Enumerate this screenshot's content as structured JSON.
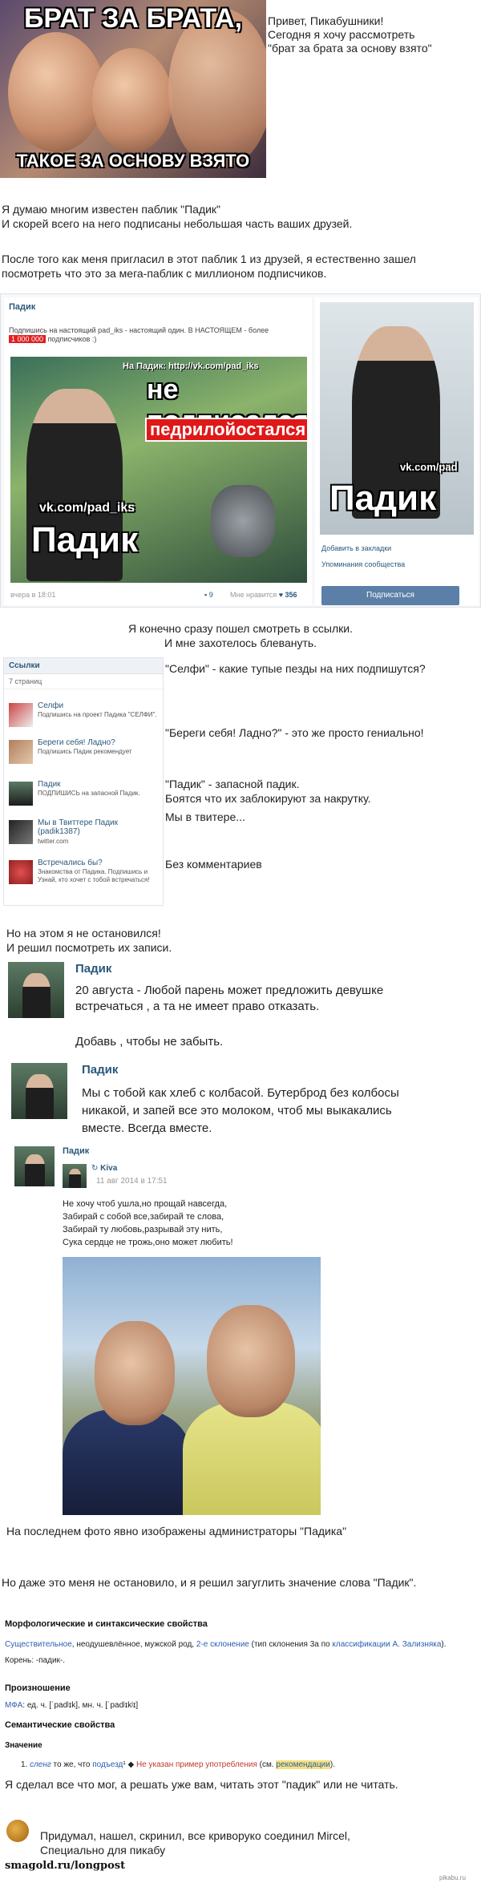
{
  "meme": {
    "top_text": "БРАТ ЗА БРАТА,",
    "bottom_text": "ТАКОЕ ЗА ОСНОВУ ВЗЯТО"
  },
  "intro": {
    "line1": "Привет, Пикабушники!",
    "line2": "Сегодня я хочу рассмотреть",
    "line3": "\"брат за брата за основу взято\""
  },
  "para1": {
    "line1": "Я думаю многим известен паблик \"Падик\"",
    "line2": "И скорей всего на него подписаны небольшая часть ваших друзей."
  },
  "para2": {
    "line1": "После того как меня пригласил в этот паблик 1 из друзей, я естественно зашел",
    "line2": "посмотреть что это за мега-паблик с миллионом подписчиков."
  },
  "vk_public": {
    "name": "Падик",
    "desc_line1": "Подпишись на настоящий pad_iks - настоящий один. В НАСТОЯЩЕМ - более",
    "desc_count": "1 000 000",
    "desc_line2": "подписчиков :)",
    "poster_url": "На Падик: http://vk.com/pad_iks",
    "poster_line1": "не подписался",
    "poster_line2": "педрилойостался",
    "poster_wm": "vk.com/pad_iks",
    "poster_big": "Падик",
    "time": "вчера в 18:01",
    "comments": "9",
    "likes_label": "Мне нравится",
    "likes": "356",
    "side_wm": "vk.com/pad",
    "side_big": "Падик",
    "bookmark": "Добавить в закладки",
    "mentions": "Упоминания сообщества",
    "subscribe": "Подписаться"
  },
  "links_intro": {
    "line1": "Я конечно сразу пошел смотреть в ссылки.",
    "line2": "И мне захотелось блевануть."
  },
  "links_panel": {
    "header": "Ссылки",
    "count": "7 страниц",
    "items": [
      {
        "title": "Селфи",
        "desc": "Подпишись на проект Падика \"СЕЛФИ\"."
      },
      {
        "title": "Береги себя! Ладно?",
        "desc": "Подпишись Падик рекомендует"
      },
      {
        "title": "Падик",
        "desc": "ПОДПИШИСЬ на запасной Падик."
      },
      {
        "title": "Мы в Твиттере Падик (padik1387)",
        "desc": "twitter.com"
      },
      {
        "title": "Встречались бы?",
        "desc": "Знакомства от Падика. Подпишись и Узнай, кто хочет с тобой встречаться!"
      }
    ]
  },
  "comments": {
    "c1": "\"Селфи\" - какие тупые пезды на них подпишутся?",
    "c2": "\"Береги себя! Ладно?\" - это же просто гениально!",
    "c3a": "\"Падик\" - запасной падик.",
    "c3b": "Боятся что их заблокируют за накрутку.",
    "c4": "Мы в твитере...",
    "c5": "Без комментариев"
  },
  "para3": {
    "line1": "Но на этом я не остановился!",
    "line2": "И решил посмотреть их записи."
  },
  "post1": {
    "name": "Падик",
    "line1": "20 августа - Любой парень может предложить девушке",
    "line2": "встречаться , а та не имеет право отказать.",
    "line3": "Добавь , чтобы не забыть."
  },
  "post2": {
    "name": "Падик",
    "line1": "Мы с тобой как хлеб с колбасой. Бутерброд без колбосы",
    "line2": "никакой, и запей все это молоком, чтоб мы выкакались",
    "line3": "вместе. Всегда вместе."
  },
  "post3": {
    "name": "Падик",
    "repost_name": "Kiva",
    "repost_date": "11 авг 2014 в 17:51",
    "lines": [
      "Не хочу чтоб ушла,но прощай навсегда,",
      "Забирай с собой все,забирай те слова,",
      "Забирай ту любовь,разрывай эту нить,",
      "Сука сердце не трожь,оно может любить!"
    ]
  },
  "para4": "На последнем фото явно изображены администраторы \"Падика\"",
  "para5": "Но даже это меня не остановило, и я решил загуглить значение слова \"Падик\".",
  "dictionary": {
    "h1": "Морфологические и синтаксические свойства",
    "morph_a": "Существительное",
    "morph_b": ", неодушевлённое, мужской род, ",
    "morph_c": "2-е склонение",
    "morph_d": " (тип склонения 3а по ",
    "morph_e": "классификации А. Зализняка",
    "morph_f": ").",
    "root": "Корень: -падик-.",
    "h2": "Произношение",
    "ipa_a": "МФА",
    "ipa_b": ": ед. ч. [ˈpadʲɪk], мн. ч. [ˈpadʲɪkʲɪ]",
    "h3": "Семантические свойства",
    "h4": "Значение",
    "mean_num": "1.",
    "mean_a": "сленг",
    "mean_b": " то же, что ",
    "mean_c": "подъезд",
    "mean_d": "¹ ◆ ",
    "mean_e": "Не указан пример употребления",
    "mean_f": " (см. ",
    "mean_g": "рекомендации",
    "mean_h": ")."
  },
  "para6": "Я сделал все что мог, а решать уже вам, читать этот \"падик\" или не читать.",
  "credits": {
    "line1": "Придумал, нашел, скринил, все криворуко соединил Mircel,",
    "line2": "Специально для пикабу"
  },
  "footer": "smagold.ru/longpost",
  "watermark": "pikabu.ru"
}
